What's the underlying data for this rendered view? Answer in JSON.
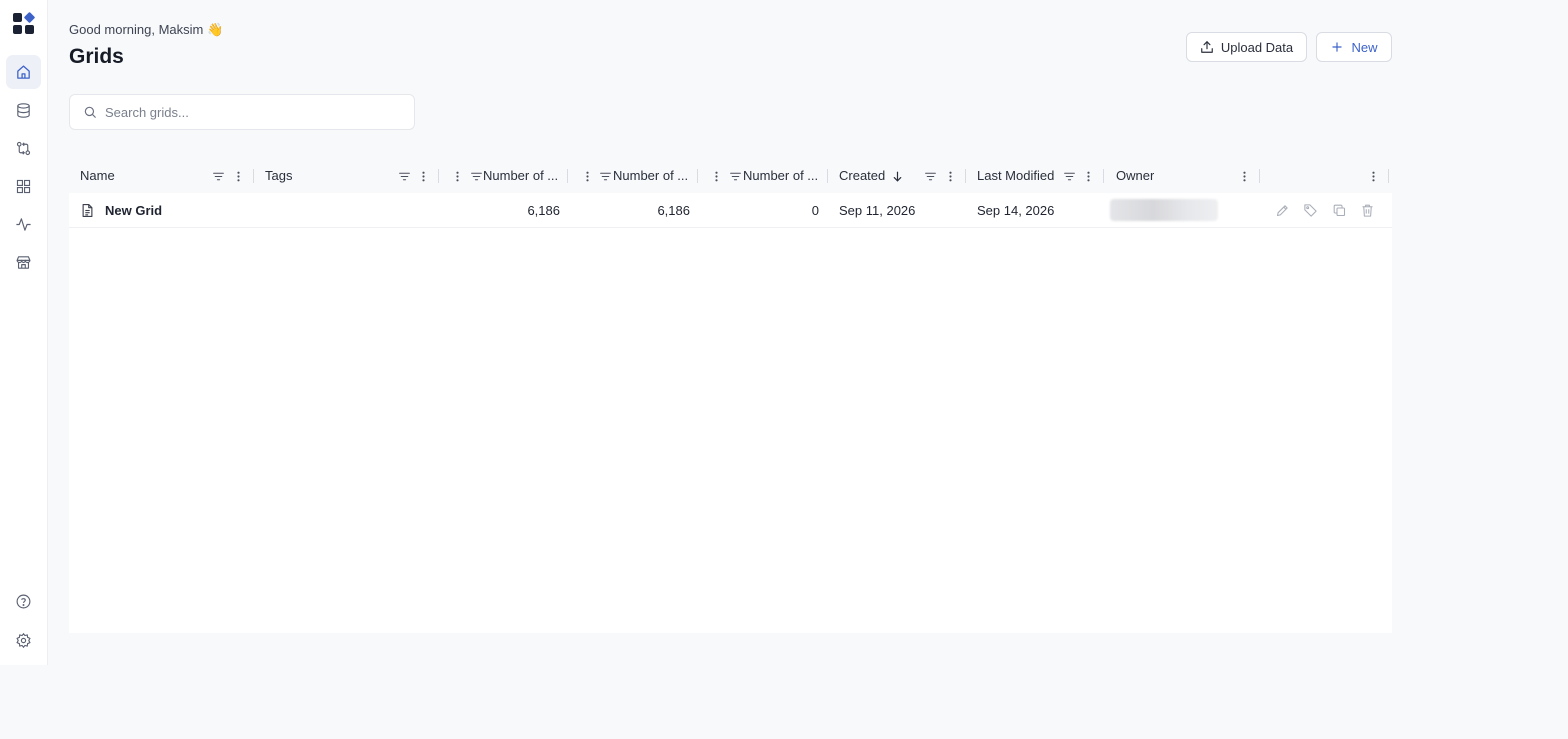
{
  "header": {
    "greeting": "Good morning, Maksim 👋",
    "title": "Grids"
  },
  "actions": {
    "upload_label": "Upload Data",
    "new_label": "New"
  },
  "search": {
    "placeholder": "Search grids..."
  },
  "sidebar": {
    "items": [
      {
        "icon": "home-icon",
        "active": true
      },
      {
        "icon": "database-icon",
        "active": false
      },
      {
        "icon": "transform-icon",
        "active": false
      },
      {
        "icon": "dashboard-icon",
        "active": false
      },
      {
        "icon": "activity-icon",
        "active": false
      },
      {
        "icon": "store-icon",
        "active": false
      }
    ],
    "bottom": [
      {
        "icon": "help-icon"
      },
      {
        "icon": "settings-icon"
      }
    ]
  },
  "table": {
    "columns": [
      "Name",
      "Tags",
      "Number of ...",
      "Number of ...",
      "Number of ...",
      "Created",
      "Last Modified",
      "Owner"
    ],
    "sort": {
      "column": "Created",
      "direction": "descending"
    },
    "rows": [
      {
        "name": "New Grid",
        "tags": "",
        "num1": "6,186",
        "num2": "6,186",
        "num3": "0",
        "created": "Sep 11, 2026",
        "modified": "Sep 14, 2026",
        "owner_hidden": true
      }
    ]
  },
  "colors": {
    "accent": "#3d63c9",
    "background": "#f8f9fb",
    "active_nav": "#eef0f8"
  }
}
